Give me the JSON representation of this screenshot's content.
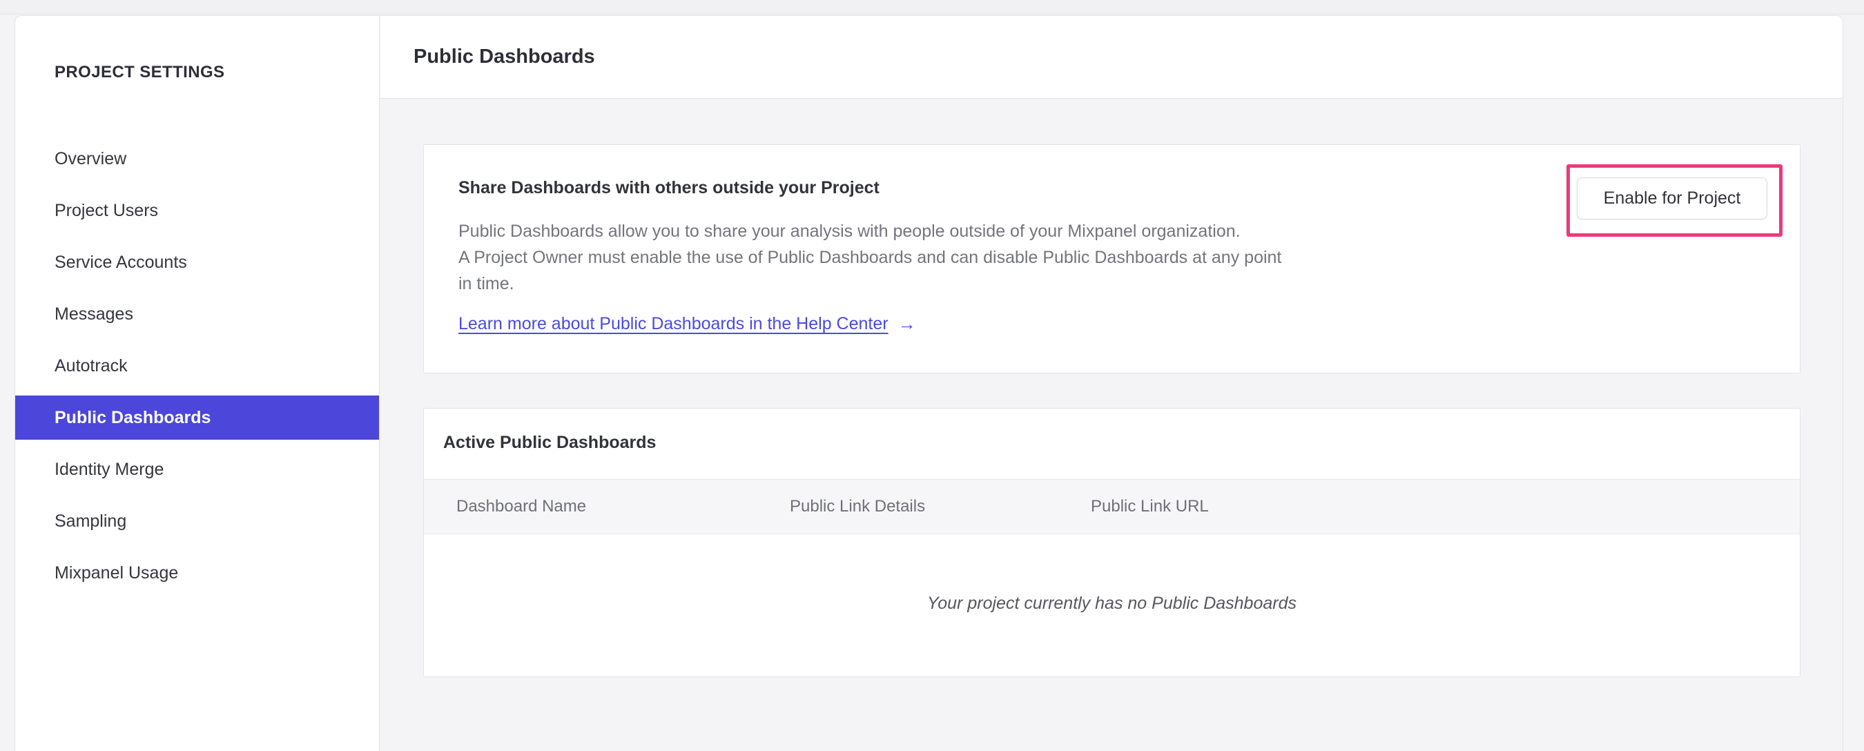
{
  "sidebar": {
    "title": "PROJECT SETTINGS",
    "items": [
      {
        "label": "Overview",
        "active": false
      },
      {
        "label": "Project Users",
        "active": false
      },
      {
        "label": "Service Accounts",
        "active": false
      },
      {
        "label": "Messages",
        "active": false
      },
      {
        "label": "Autotrack",
        "active": false
      },
      {
        "label": "Public Dashboards",
        "active": true
      },
      {
        "label": "Identity Merge",
        "active": false
      },
      {
        "label": "Sampling",
        "active": false
      },
      {
        "label": "Mixpanel Usage",
        "active": false
      }
    ]
  },
  "header": {
    "title": "Public Dashboards"
  },
  "share_card": {
    "title": "Share Dashboards with others outside your Project",
    "description_lines": [
      "Public Dashboards allow you to share your analysis with people outside of your Mixpanel organization.",
      "A Project Owner must enable the use of Public Dashboards and can disable Public Dashboards at any point",
      "in time."
    ],
    "link_label": "Learn more about Public Dashboards in the Help Center",
    "link_arrow": "→",
    "button_label": "Enable for Project"
  },
  "active_card": {
    "title": "Active Public Dashboards",
    "columns": [
      "Dashboard Name",
      "Public Link Details",
      "Public Link URL"
    ],
    "rows": [],
    "empty_message": "Your project currently has no Public Dashboards"
  },
  "colors": {
    "sidebar_active_purple": "#4c46db",
    "link_purple": "#4b4ae0",
    "highlight_pink": "#ea3a7d",
    "page_background": "#f4f4f6"
  }
}
